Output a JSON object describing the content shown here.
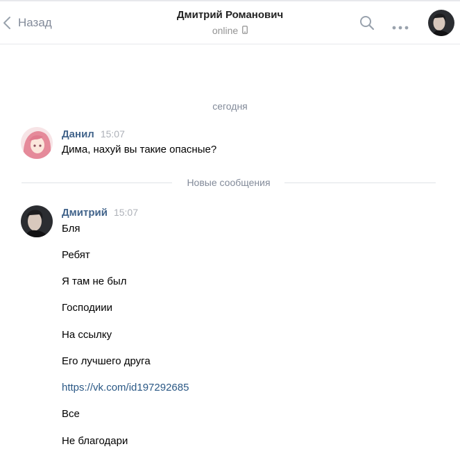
{
  "header": {
    "back_label": "Назад",
    "peer_name": "Дмитрий Романович",
    "peer_status": "online",
    "search_icon": "search-icon",
    "more_icon": "more-horizontal-icon",
    "phone_icon": "mobile-phone-icon"
  },
  "history": {
    "date_separator": "сегодня",
    "new_messages_label": "Новые сообщения",
    "groups": [
      {
        "author": "Данил",
        "time": "15:07",
        "messages": [
          "Дима, нахуй вы такие опасные?"
        ]
      },
      {
        "author": "Дмитрий",
        "time": "15:07",
        "messages": [
          "Бля",
          "Ребят",
          "Я там не был",
          "Господиии",
          "На ссылку",
          "Его лучшего друга",
          "https://vk.com/id197292685",
          "Все",
          "Не благодари"
        ]
      }
    ]
  },
  "colors": {
    "author": "#42648b",
    "link": "#2a5885",
    "muted": "#828a99",
    "divider": "#e7e8ec"
  }
}
